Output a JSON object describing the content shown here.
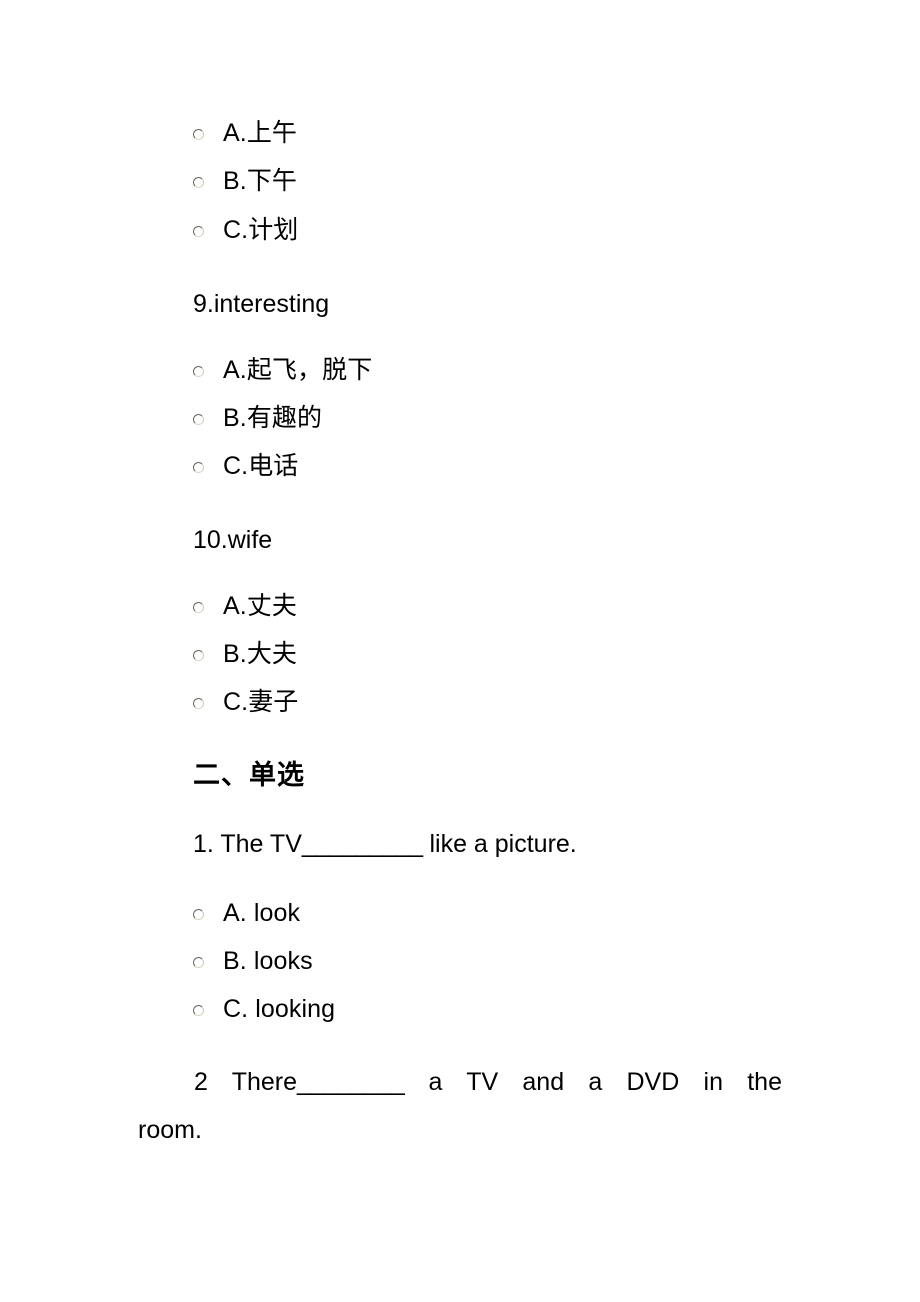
{
  "document": {
    "background_color": "#ffffff",
    "text_color": "#000000"
  },
  "questions": [
    {
      "id": "q8-options",
      "stem": null,
      "options": [
        {
          "label": "A.上午"
        },
        {
          "label": "B.下午"
        },
        {
          "label": "C.计划"
        }
      ]
    },
    {
      "id": "q9",
      "stem": "9.interesting",
      "options": [
        {
          "label": "A.起飞，脱下"
        },
        {
          "label": "B.有趣的"
        },
        {
          "label": "C.电话"
        }
      ]
    },
    {
      "id": "q10",
      "stem": "10.wife",
      "options": [
        {
          "label": "A.丈夫"
        },
        {
          "label": "B.大夫"
        },
        {
          "label": "C.妻子"
        }
      ]
    }
  ],
  "section": {
    "heading": "二、单选",
    "questions": [
      {
        "id": "s2-q1",
        "stem_prefix": "1. The TV",
        "stem_blank": "_________",
        "stem_suffix": " like a picture.",
        "options": [
          {
            "label": "A. look"
          },
          {
            "label": "B. looks"
          },
          {
            "label": "C. looking"
          }
        ]
      },
      {
        "id": "s2-q2",
        "line1_prefix": "2  There",
        "line1_blank": "________",
        "line1_suffix": " a TV and a DVD in the",
        "line2": "room."
      }
    ]
  }
}
